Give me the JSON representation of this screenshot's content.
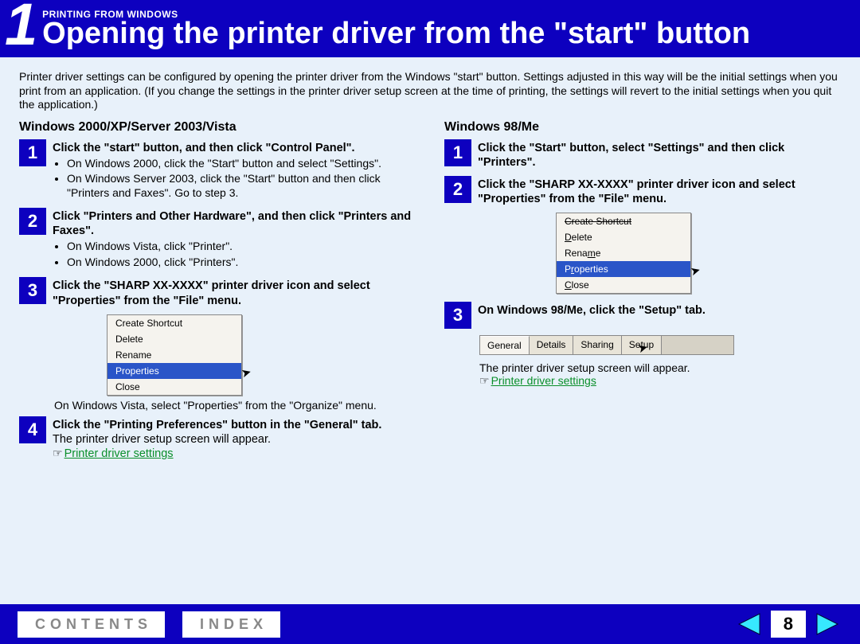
{
  "header": {
    "chapter_num": "1",
    "kicker": "PRINTING FROM WINDOWS",
    "title": "Opening the printer driver from the \"start\" button"
  },
  "intro": "Printer driver settings can be configured by opening the printer driver from the Windows \"start\" button. Settings adjusted in this way will be the initial settings when you print from an application. (If you change the settings in the printer driver setup screen at the time of printing, the settings will revert to the initial settings when you quit the application.)",
  "left": {
    "heading": "Windows 2000/XP/Server 2003/Vista",
    "step1_title": "Click the \"start\" button, and then click \"Control Panel\".",
    "step1_b1": "On Windows 2000, click the \"Start\" button and select \"Settings\".",
    "step1_b2": "On Windows Server 2003, click the \"Start\" button and then click \"Printers and Faxes\". Go to step 3.",
    "step2_title": "Click \"Printers and Other Hardware\", and then click \"Printers and Faxes\".",
    "step2_b1": "On Windows Vista, click \"Printer\".",
    "step2_b2": "On Windows 2000, click \"Printers\".",
    "step3_title": "Click the \"SHARP XX-XXXX\" printer driver icon and select \"Properties\" from the \"File\" menu.",
    "menu": {
      "i1": "Create Shortcut",
      "i2": "Delete",
      "i3": "Rename",
      "i4": "Properties",
      "i5": "Close"
    },
    "after_menu": "On Windows Vista, select \"Properties\" from the \"Organize\" menu.",
    "step4_title": "Click the \"Printing Preferences\" button in the \"General\" tab.",
    "step4_after": "The printer driver setup screen will appear.",
    "link": "Printer driver settings"
  },
  "right": {
    "heading": "Windows 98/Me",
    "step1_title": "Click the \"Start\" button, select \"Settings\" and then click \"Printers\".",
    "step2_title": "Click the \"SHARP XX-XXXX\" printer driver icon and select \"Properties\" from the \"File\" menu.",
    "menu": {
      "i1": "Create Shortcut",
      "i2": "Delete",
      "i3": "Rename",
      "i4": "Properties",
      "i5": "Close"
    },
    "step3_title": "On Windows 98/Me, click the \"Setup\" tab.",
    "tabs": {
      "t1": "General",
      "t2": "Details",
      "t3": "Sharing",
      "t4": "Setup"
    },
    "after_tabs": "The printer driver setup screen will appear.",
    "link": "Printer driver settings"
  },
  "footer": {
    "contents": "CONTENTS",
    "index": "INDEX",
    "page": "8"
  }
}
